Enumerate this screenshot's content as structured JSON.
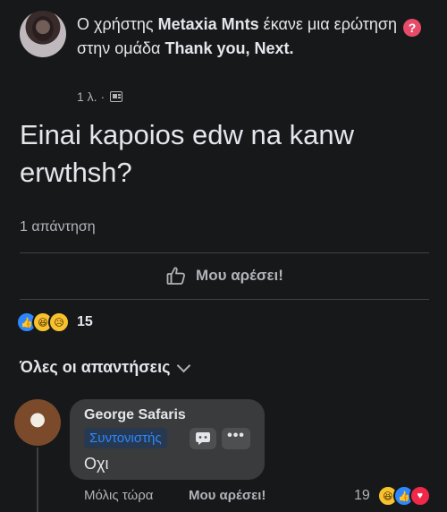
{
  "post": {
    "header_prefix": "Ο χρήστης",
    "author": "Metaxia Mnts",
    "header_mid": "έκανε μια ερώτηση",
    "header_group_prefix": "στην ομάδα",
    "group": "Thank you, Next.",
    "time": "1 λ. ·",
    "text": "Einai kapoios edw na kanw erwthsh?",
    "answers_count": "1 απάντηση",
    "like_label": "Μου αρέσει!",
    "reaction_count": "15"
  },
  "answers_section": {
    "title": "Όλες οι απαντήσεις"
  },
  "comment": {
    "author": "George Safaris",
    "badge": "Συντονιστής",
    "more": "•••",
    "text": "Οχι",
    "time": "Μόλις τώρα",
    "like_label": "Μου αρέσει!",
    "reaction_count": "19"
  },
  "icons": {
    "question": "question-icon",
    "group": "group-icon",
    "like": "thumbs-up-icon",
    "moderator": "moderator-chat-icon"
  },
  "colors": {
    "background": "#17181a",
    "bubble": "#3a3b3c",
    "accent_blue": "#2d88ff",
    "question_pink": "#e84b6a"
  }
}
